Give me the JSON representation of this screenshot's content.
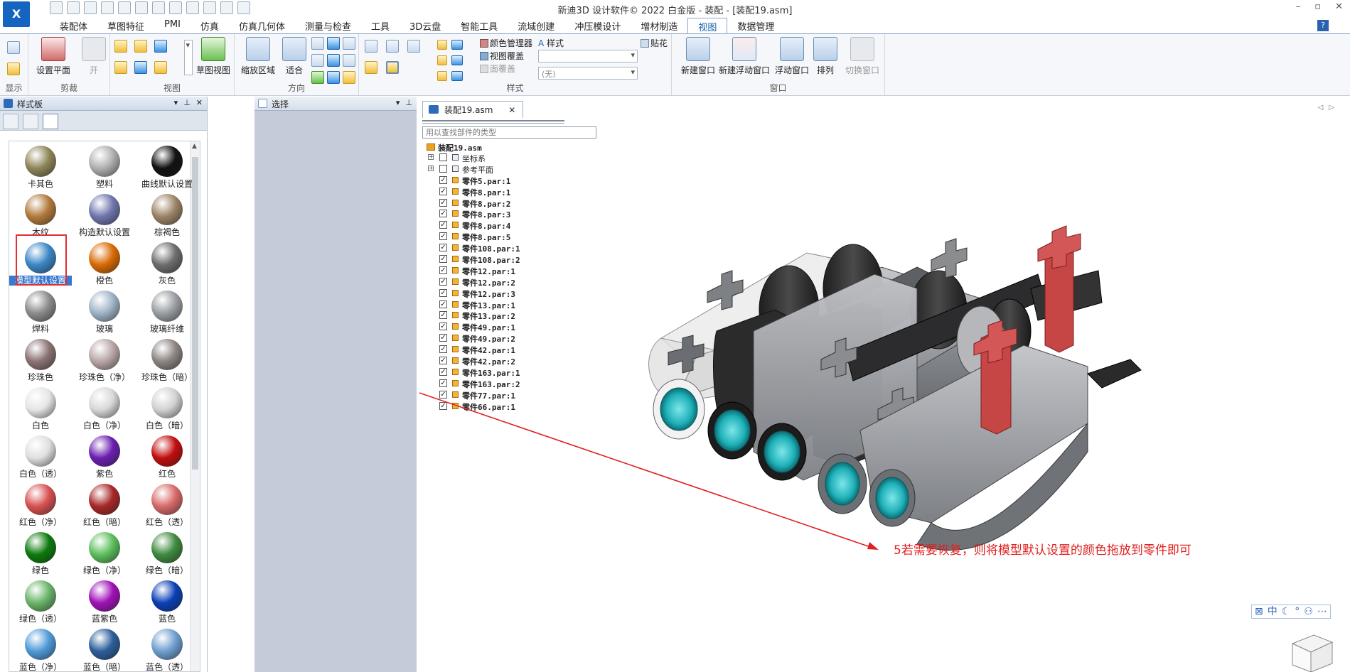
{
  "app": {
    "window_title": "新迪3D 设计软件© 2022 白金版 - 装配 - [装配19.asm]",
    "win_controls": [
      "–",
      "▫",
      "✕"
    ]
  },
  "menu_tabs": [
    "装配体",
    "草图特征",
    "PMI",
    "仿真",
    "仿真几何体",
    "测量与检查",
    "工具",
    "3D云盘",
    "智能工具",
    "流域创建",
    "冲压模设计",
    "增材制造",
    "视图",
    "数据管理"
  ],
  "active_menu_tab": "视图",
  "help_label": "?",
  "ribbon": {
    "groups": {
      "display": "显示",
      "clip": "剪裁",
      "view": "视图",
      "direction": "方向",
      "style": "样式",
      "window": "窗口"
    },
    "buttons": {
      "set_plane": "设置平面",
      "open": "开",
      "sketch_view": "草图视图",
      "zoom_area": "缩放区域",
      "fit": "适合",
      "color_manager": "颜色管理器",
      "view_overlay": "视图覆盖",
      "face_overlay": "面覆盖",
      "style": "样式",
      "decal": "贴花",
      "style_combo_value": "",
      "style_combo_none": "(无)",
      "new_window": "新建窗口",
      "new_float_window": "新建浮动窗口",
      "float_window": "浮动窗口",
      "arrange": "排列",
      "switch_window": "切换窗口"
    }
  },
  "palette_panel": {
    "title": "样式板",
    "materials": [
      {
        "label": "卡其色",
        "color": "#8e8659"
      },
      {
        "label": "塑料",
        "color": "#b0b0b0"
      },
      {
        "label": "曲线默认设置",
        "color": "#111111"
      },
      {
        "label": "木纹",
        "color": "#b27a3c"
      },
      {
        "label": "构造默认设置",
        "color": "#7075ad"
      },
      {
        "label": "棕褐色",
        "color": "#9b8466"
      },
      {
        "label": "模型默认设置",
        "color": "#3b86c6",
        "selected": true
      },
      {
        "label": "橙色",
        "color": "#d96a05"
      },
      {
        "label": "灰色",
        "color": "#6d6d6d"
      },
      {
        "label": "焊料",
        "color": "#8c8c8c"
      },
      {
        "label": "玻璃",
        "color": "#9fb4c6"
      },
      {
        "label": "玻璃纤维",
        "color": "#9a9fa4"
      },
      {
        "label": "珍珠色",
        "color": "#8a7373"
      },
      {
        "label": "珍珠色（净）",
        "color": "#b9a6a6"
      },
      {
        "label": "珍珠色（暗）",
        "color": "#8c8480"
      },
      {
        "label": "白色",
        "color": "#e6e6e6"
      },
      {
        "label": "白色（净）",
        "color": "#d8d8d8"
      },
      {
        "label": "白色（暗）",
        "color": "#d2d2d2"
      },
      {
        "label": "白色（透）",
        "color": "#e0e0e0"
      },
      {
        "label": "紫色",
        "color": "#6a1fb0"
      },
      {
        "label": "红色",
        "color": "#c20d0d"
      },
      {
        "label": "红色（净）",
        "color": "#d85050"
      },
      {
        "label": "红色（暗）",
        "color": "#a82828"
      },
      {
        "label": "红色（透）",
        "color": "#d86a6a"
      },
      {
        "label": "绿色",
        "color": "#0c7a0c"
      },
      {
        "label": "绿色（净）",
        "color": "#5cbf5c"
      },
      {
        "label": "绿色（暗）",
        "color": "#3f8a3f"
      },
      {
        "label": "绿色（透）",
        "color": "#6ab46a"
      },
      {
        "label": "蓝紫色",
        "color": "#a010b8"
      },
      {
        "label": "蓝色",
        "color": "#0a3fb6"
      },
      {
        "label": "蓝色（净）",
        "color": "#4f9ad9"
      },
      {
        "label": "蓝色（暗）",
        "color": "#2d5e9a"
      },
      {
        "label": "蓝色（透）",
        "color": "#6f9fd0"
      }
    ]
  },
  "select_panel": {
    "title": "选择"
  },
  "document": {
    "tab_label": "装配19.asm",
    "tab_close": "✕",
    "search_placeholder": "用以查找部件的类型",
    "tree_root": "装配19.asm",
    "tree_items": [
      {
        "label": "坐标系",
        "kind": "system",
        "expandable": true,
        "checked": false
      },
      {
        "label": "参考平面",
        "kind": "system",
        "expandable": true,
        "checked": false
      },
      {
        "label": "零件5.par:1",
        "kind": "part",
        "checked": true
      },
      {
        "label": "零件8.par:1",
        "kind": "part",
        "checked": true
      },
      {
        "label": "零件8.par:2",
        "kind": "part",
        "checked": true
      },
      {
        "label": "零件8.par:3",
        "kind": "part",
        "checked": true
      },
      {
        "label": "零件8.par:4",
        "kind": "part",
        "checked": true
      },
      {
        "label": "零件8.par:5",
        "kind": "part",
        "checked": true
      },
      {
        "label": "零件108.par:1",
        "kind": "part",
        "checked": true
      },
      {
        "label": "零件108.par:2",
        "kind": "part",
        "checked": true
      },
      {
        "label": "零件12.par:1",
        "kind": "part",
        "checked": true
      },
      {
        "label": "零件12.par:2",
        "kind": "part",
        "checked": true
      },
      {
        "label": "零件12.par:3",
        "kind": "part",
        "checked": true
      },
      {
        "label": "零件13.par:1",
        "kind": "part",
        "checked": true
      },
      {
        "label": "零件13.par:2",
        "kind": "part",
        "checked": true
      },
      {
        "label": "零件49.par:1",
        "kind": "part",
        "checked": true
      },
      {
        "label": "零件49.par:2",
        "kind": "part",
        "checked": true
      },
      {
        "label": "零件42.par:1",
        "kind": "part",
        "checked": true
      },
      {
        "label": "零件42.par:2",
        "kind": "part",
        "checked": true
      },
      {
        "label": "零件163.par:1",
        "kind": "part",
        "checked": true
      },
      {
        "label": "零件163.par:2",
        "kind": "part",
        "checked": true
      },
      {
        "label": "零件77.par:1",
        "kind": "part",
        "checked": true
      },
      {
        "label": "零件66.par:1",
        "kind": "part",
        "checked": true
      }
    ]
  },
  "annotation": "5若需要恢复，则将模型默认设置的颜色拖放到零件即可",
  "colors": {
    "annotation_red": "#e02020",
    "teal_hole": "#1fb0b8",
    "part_red": "#c64545",
    "part_dark": "#2a2a2a",
    "part_gray": "#8a8c90"
  },
  "status_icons": [
    "⊠",
    "中",
    "☾",
    "°",
    "⚇",
    "⋯"
  ]
}
